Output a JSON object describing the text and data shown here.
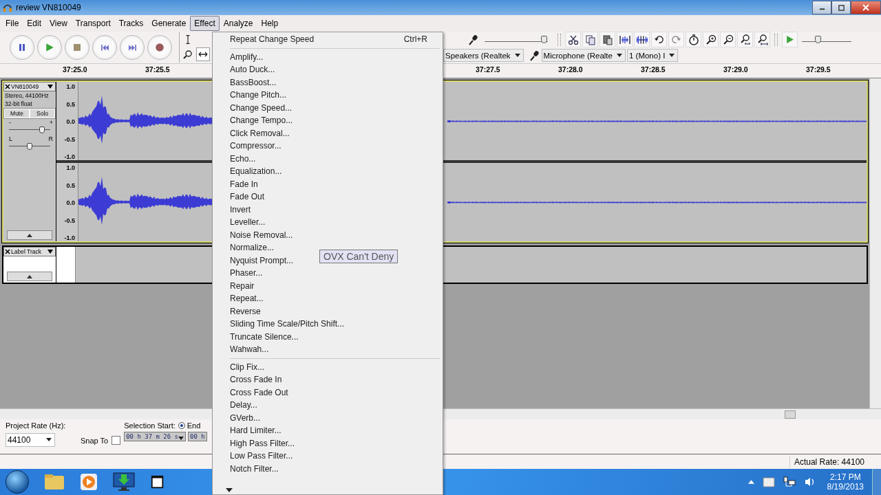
{
  "window": {
    "title": "review VN810049"
  },
  "menu_bar": [
    {
      "label": "File",
      "selected": false
    },
    {
      "label": "Edit",
      "selected": false
    },
    {
      "label": "View",
      "selected": false
    },
    {
      "label": "Transport",
      "selected": false
    },
    {
      "label": "Tracks",
      "selected": false
    },
    {
      "label": "Generate",
      "selected": false
    },
    {
      "label": "Effect",
      "selected": true
    },
    {
      "label": "Analyze",
      "selected": false
    },
    {
      "label": "Help",
      "selected": false
    }
  ],
  "mixer": {
    "input_volume": {
      "level": 1.0
    }
  },
  "device_toolbar": {
    "output": "Speakers (Realtek",
    "input": "Microphone (Realte",
    "channels": "1 (Mono) I"
  },
  "play_at_speed": {
    "level": 0.3
  },
  "ruler": {
    "ticks": [
      "37:25.0",
      "37:25.5",
      "37:27.5",
      "37:28.0",
      "37:28.5",
      "37:29.0",
      "37:29.5"
    ]
  },
  "tracks": [
    {
      "kind": "audio",
      "name": "VN810049",
      "selected": true,
      "info": [
        "Stereo, 44100Hz",
        "32-bit float"
      ],
      "mute": "Mute",
      "solo": "Solo",
      "gain": {
        "min": "-",
        "max": "+",
        "level": 0.8
      },
      "pan": {
        "min": "L",
        "max": "R",
        "level": 0.5
      },
      "channels": [
        {
          "axis": [
            "1.0",
            "0.5",
            "0.0",
            "-0.5",
            "-1.0"
          ]
        },
        {
          "axis": [
            "1.0",
            "0.5",
            "0.0",
            "-0.5",
            "-1.0"
          ]
        }
      ]
    },
    {
      "kind": "label",
      "name": "Label Track",
      "selected": false,
      "labels": [
        "OVX Can't Deny"
      ]
    }
  ],
  "effect_menu": {
    "items": [
      {
        "kind": "item",
        "label": "Repeat Change Speed",
        "shortcut": "Ctrl+R"
      },
      {
        "kind": "separator"
      },
      {
        "kind": "item",
        "label": "Amplify..."
      },
      {
        "kind": "item",
        "label": "Auto Duck..."
      },
      {
        "kind": "item",
        "label": "BassBoost..."
      },
      {
        "kind": "item",
        "label": "Change Pitch..."
      },
      {
        "kind": "item",
        "label": "Change Speed..."
      },
      {
        "kind": "item",
        "label": "Change Tempo..."
      },
      {
        "kind": "item",
        "label": "Click Removal..."
      },
      {
        "kind": "item",
        "label": "Compressor..."
      },
      {
        "kind": "item",
        "label": "Echo..."
      },
      {
        "kind": "item",
        "label": "Equalization..."
      },
      {
        "kind": "item",
        "label": "Fade In"
      },
      {
        "kind": "item",
        "label": "Fade Out"
      },
      {
        "kind": "item",
        "label": "Invert"
      },
      {
        "kind": "item",
        "label": "Leveller..."
      },
      {
        "kind": "item",
        "label": "Noise Removal..."
      },
      {
        "kind": "item",
        "label": "Normalize..."
      },
      {
        "kind": "item",
        "label": "Nyquist Prompt..."
      },
      {
        "kind": "item",
        "label": "Phaser..."
      },
      {
        "kind": "item",
        "label": "Repair"
      },
      {
        "kind": "item",
        "label": "Repeat..."
      },
      {
        "kind": "item",
        "label": "Reverse"
      },
      {
        "kind": "item",
        "label": "Sliding Time Scale/Pitch Shift..."
      },
      {
        "kind": "item",
        "label": "Truncate Silence..."
      },
      {
        "kind": "item",
        "label": "Wahwah..."
      },
      {
        "kind": "separator"
      },
      {
        "kind": "item",
        "label": "Clip Fix..."
      },
      {
        "kind": "item",
        "label": "Cross Fade In"
      },
      {
        "kind": "item",
        "label": "Cross Fade Out"
      },
      {
        "kind": "item",
        "label": "Delay..."
      },
      {
        "kind": "item",
        "label": "GVerb..."
      },
      {
        "kind": "item",
        "label": "Hard Limiter..."
      },
      {
        "kind": "item",
        "label": "High Pass Filter..."
      },
      {
        "kind": "item",
        "label": "Low Pass Filter..."
      },
      {
        "kind": "item",
        "label": "Notch Filter..."
      }
    ]
  },
  "selection_toolbar": {
    "project_rate_label": "Project Rate (Hz):",
    "project_rate": "44100",
    "snap_to_label": "Snap To",
    "snap_to": false,
    "selection_start_label": "Selection Start:",
    "end_label": "End",
    "end_selected": true,
    "start_time": "00 h 37 m 26 s",
    "end_time": "00 h"
  },
  "status_bar": {
    "actual_rate": "Actual Rate: 44100"
  },
  "taskbar": {
    "time": "2:17 PM",
    "date": "8/19/2013"
  }
}
